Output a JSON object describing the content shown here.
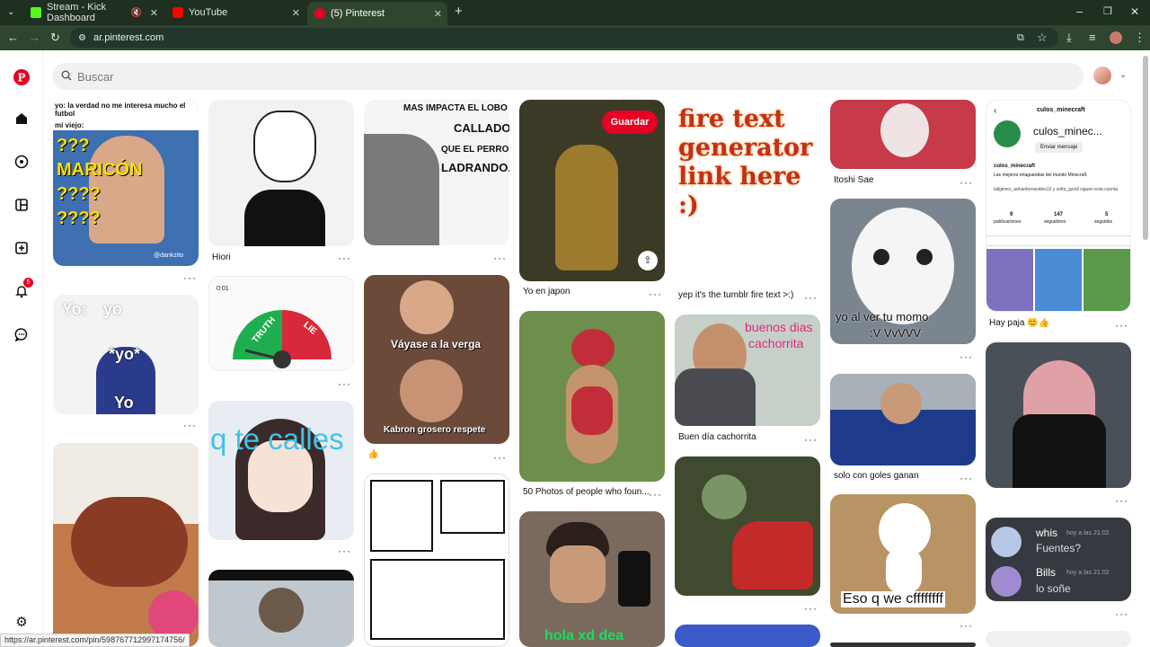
{
  "tabs": [
    {
      "title": "Stream - Kick Dashboard"
    },
    {
      "title": "YouTube"
    },
    {
      "title": "(5) Pinterest"
    }
  ],
  "address": {
    "url": "ar.pinterest.com"
  },
  "sidebar": {
    "notif_count": "5"
  },
  "search": {
    "placeholder": "Buscar"
  },
  "save_label": "Guardar",
  "pins": {
    "p1": {
      "line1": "yo: la verdad no me interesa mucho el",
      "line2": "futbol",
      "line3": "mi viejo:",
      "big": "???\nMARICÓN\n????\n????",
      "wm": "@dankzito"
    },
    "p2": {
      "caption": "Hiori"
    },
    "p3": {
      "t1": "MAS IMPACTA EL LOBO",
      "t2": "CALLADO",
      "t3": "QUE EL PERRO",
      "t4": "LADRANDO."
    },
    "p4": {
      "caption": "Yo en japon"
    },
    "p5": {
      "text": "fire text generator link here :)",
      "caption": "yep it's the tumblr fire text >:)"
    },
    "p6": {
      "caption": "Itoshi Sae"
    },
    "p7": {
      "username": "culos_minecraft",
      "handle": "culos_minec...",
      "msg": "Enviar mensaje",
      "bio_name": "culos_minecraft",
      "bio": "Las mejores retaguardias del mundo Minecraft.",
      "tags": "lallgimez_adrianbenavides15 y sofia_gzzdl siguen esta cuenta",
      "stats": [
        {
          "n": "9",
          "l": "publicaciones"
        },
        {
          "n": "147",
          "l": "seguidores"
        },
        {
          "n": "5",
          "l": "seguidos"
        }
      ],
      "caption": "Hay paja 😊👍"
    },
    "p8": {
      "a": "Yo:",
      "b": "yo",
      "c": "*yo*",
      "d": "Yo"
    },
    "p9": {
      "time": "0:01",
      "truth": "TRUTH",
      "lie": "LIE"
    },
    "p10": {
      "t1": "Váyase a la verga",
      "t2": "Kabron grosero respete",
      "caption": "👍"
    },
    "p11": {
      "caption": "50 Photos of people who foun..."
    },
    "p12": {
      "t1": "buenos dias",
      "t2": "cachorrita",
      "caption": "Buen día cachorrita"
    },
    "p13": {
      "t1": "yo al ver tu momo",
      "t2": ":V VvVVV"
    },
    "p14": {
      "caption": "solo con goles ganan"
    },
    "p15": {
      "text": "q te calles"
    },
    "p16": {
      "t1": "Eso q we cffffffff"
    },
    "p17": {
      "text": "hola xd dea"
    },
    "p18": {
      "m1name": "whis",
      "m1time": "hoy a las 21:02",
      "m1text": "Fuentes?",
      "m2name": "Bills",
      "m2time": "hoy a las 21:02",
      "m2text": "lo soñe"
    }
  },
  "status_url": "https://ar.pinterest.com/pin/598767712997174756/"
}
